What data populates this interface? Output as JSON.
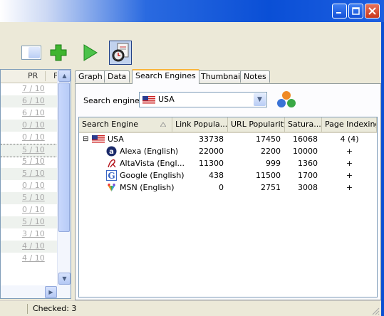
{
  "window": {
    "controls": [
      "minimize",
      "maximize",
      "close"
    ]
  },
  "left_list": {
    "columns": [
      "PR",
      "F"
    ],
    "rows": [
      "7 / 10",
      "6 / 10",
      "6 / 10",
      "0 / 10",
      "0 / 10",
      "5 / 10",
      "5 / 10",
      "5 / 10",
      "0 / 10",
      "5 / 10",
      "0 / 10",
      "5 / 10",
      "3 / 10",
      "4 / 10",
      "4 / 10"
    ]
  },
  "tabs": [
    "Graph",
    "Data",
    "Search Engines",
    "Thumbnail",
    "Notes"
  ],
  "active_tab": "Search Engines",
  "search_engine": {
    "label": "Search engine",
    "value": "USA"
  },
  "table": {
    "columns": [
      "Search Engine",
      "Link Popula...",
      "URL Popularity",
      "Satura...",
      "Page Indexing"
    ],
    "rows": [
      {
        "icon": "us-flag-icon",
        "expander": "⊟",
        "name": "USA",
        "link": "33738",
        "url": "17450",
        "sat": "16068",
        "idx": "4 (4)"
      },
      {
        "icon": "alexa-icon",
        "name": "Alexa (English)",
        "link": "22000",
        "url": "2200",
        "sat": "10000",
        "idx": "+"
      },
      {
        "icon": "altavista-icon",
        "name": "AltaVista (Engl...",
        "link": "11300",
        "url": "999",
        "sat": "1360",
        "idx": "+"
      },
      {
        "icon": "google-icon",
        "name": "Google (English)",
        "link": "438",
        "url": "11500",
        "sat": "1700",
        "idx": "+"
      },
      {
        "icon": "msn-icon",
        "name": "MSN (English)",
        "link": "0",
        "url": "2751",
        "sat": "3008",
        "idx": "+"
      }
    ]
  },
  "status": {
    "checked": "Checked: 3"
  },
  "colors": {
    "title_bar": "#0a4fd6",
    "active_tab_accent": "#f9b53b",
    "face": "#ece9d8"
  }
}
